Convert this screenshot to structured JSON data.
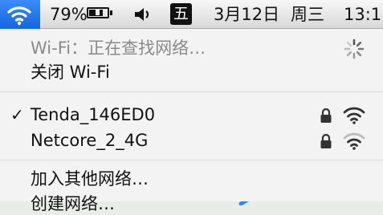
{
  "menubar": {
    "battery_percent": "79%",
    "battery_level": 0.79,
    "input_method": "五",
    "date": "3月12日",
    "weekday": "周三",
    "time": "13:1"
  },
  "menu": {
    "status_text": "Wi-Fi：正在查找网络…",
    "turn_off_label": "关闭 Wi-Fi",
    "networks": [
      {
        "name": "Tenda_146ED0",
        "selected": true,
        "locked": true
      },
      {
        "name": "Netcore_2_4G",
        "selected": false,
        "locked": true
      }
    ],
    "checkmark": "✓",
    "join_other_label": "加入其他网络…",
    "create_network_label": "创建网络…"
  },
  "icons": {
    "wifi": "wifi-icon",
    "battery": "battery-icon",
    "volume": "volume-icon",
    "spinner": "spinner-icon",
    "lock": "lock-icon"
  },
  "colors": {
    "wifi_highlight": "#1f6fe8",
    "menu_background": "#f3f3f3",
    "menubar_background": "#e4e4e4"
  }
}
